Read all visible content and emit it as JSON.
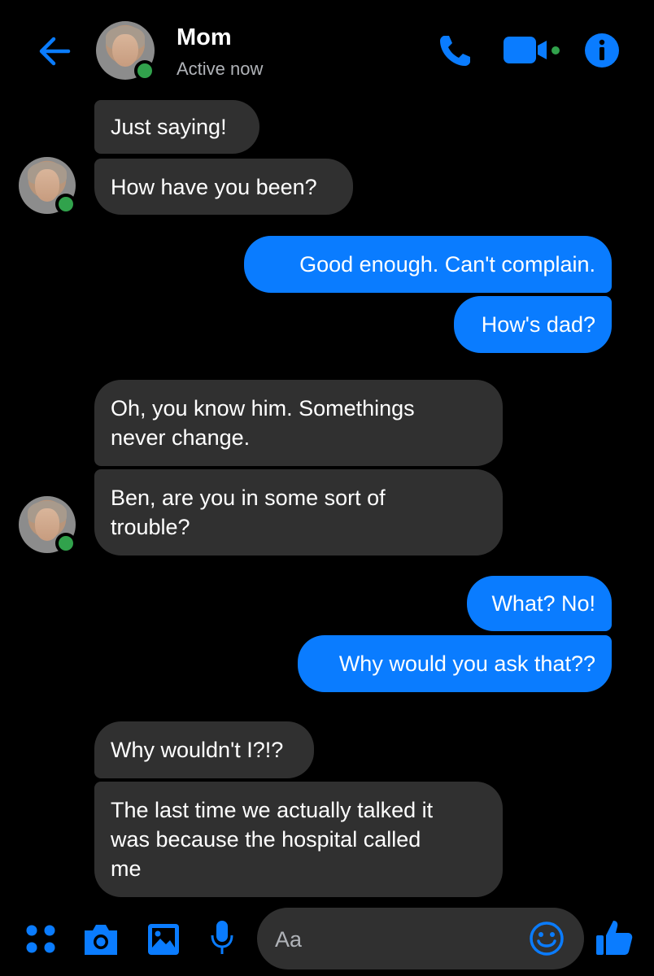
{
  "header": {
    "contact_name": "Mom",
    "status": "Active now",
    "back_icon": "arrow-left-icon",
    "call_icon": "phone-icon",
    "video_icon": "video-camera-icon",
    "info_icon": "info-icon"
  },
  "messages": [
    {
      "sender": "them",
      "text": "Just saying!"
    },
    {
      "sender": "them",
      "text": "How have you been?"
    },
    {
      "sender": "me",
      "text": "Good enough. Can't complain."
    },
    {
      "sender": "me",
      "text": "How's dad?"
    },
    {
      "sender": "them",
      "text": "Oh, you know him. Somethings\nnever change."
    },
    {
      "sender": "them",
      "text": "Ben, are you in some sort of\ntrouble?"
    },
    {
      "sender": "me",
      "text": "What? No!"
    },
    {
      "sender": "me",
      "text": "Why would you ask that??"
    },
    {
      "sender": "them",
      "text": "Why wouldn't I?!?"
    },
    {
      "sender": "them",
      "text": "The last time we actually talked it\nwas because the hospital called\nme"
    }
  ],
  "composer": {
    "placeholder": "Aa",
    "icons": [
      "apps-icon",
      "camera-icon",
      "gallery-icon",
      "microphone-icon",
      "emoji-icon",
      "thumbs-up-icon"
    ]
  },
  "colors": {
    "accent": "#0a7cff",
    "incoming_bubble": "#303030",
    "online": "#31a24c",
    "background": "#000000"
  }
}
